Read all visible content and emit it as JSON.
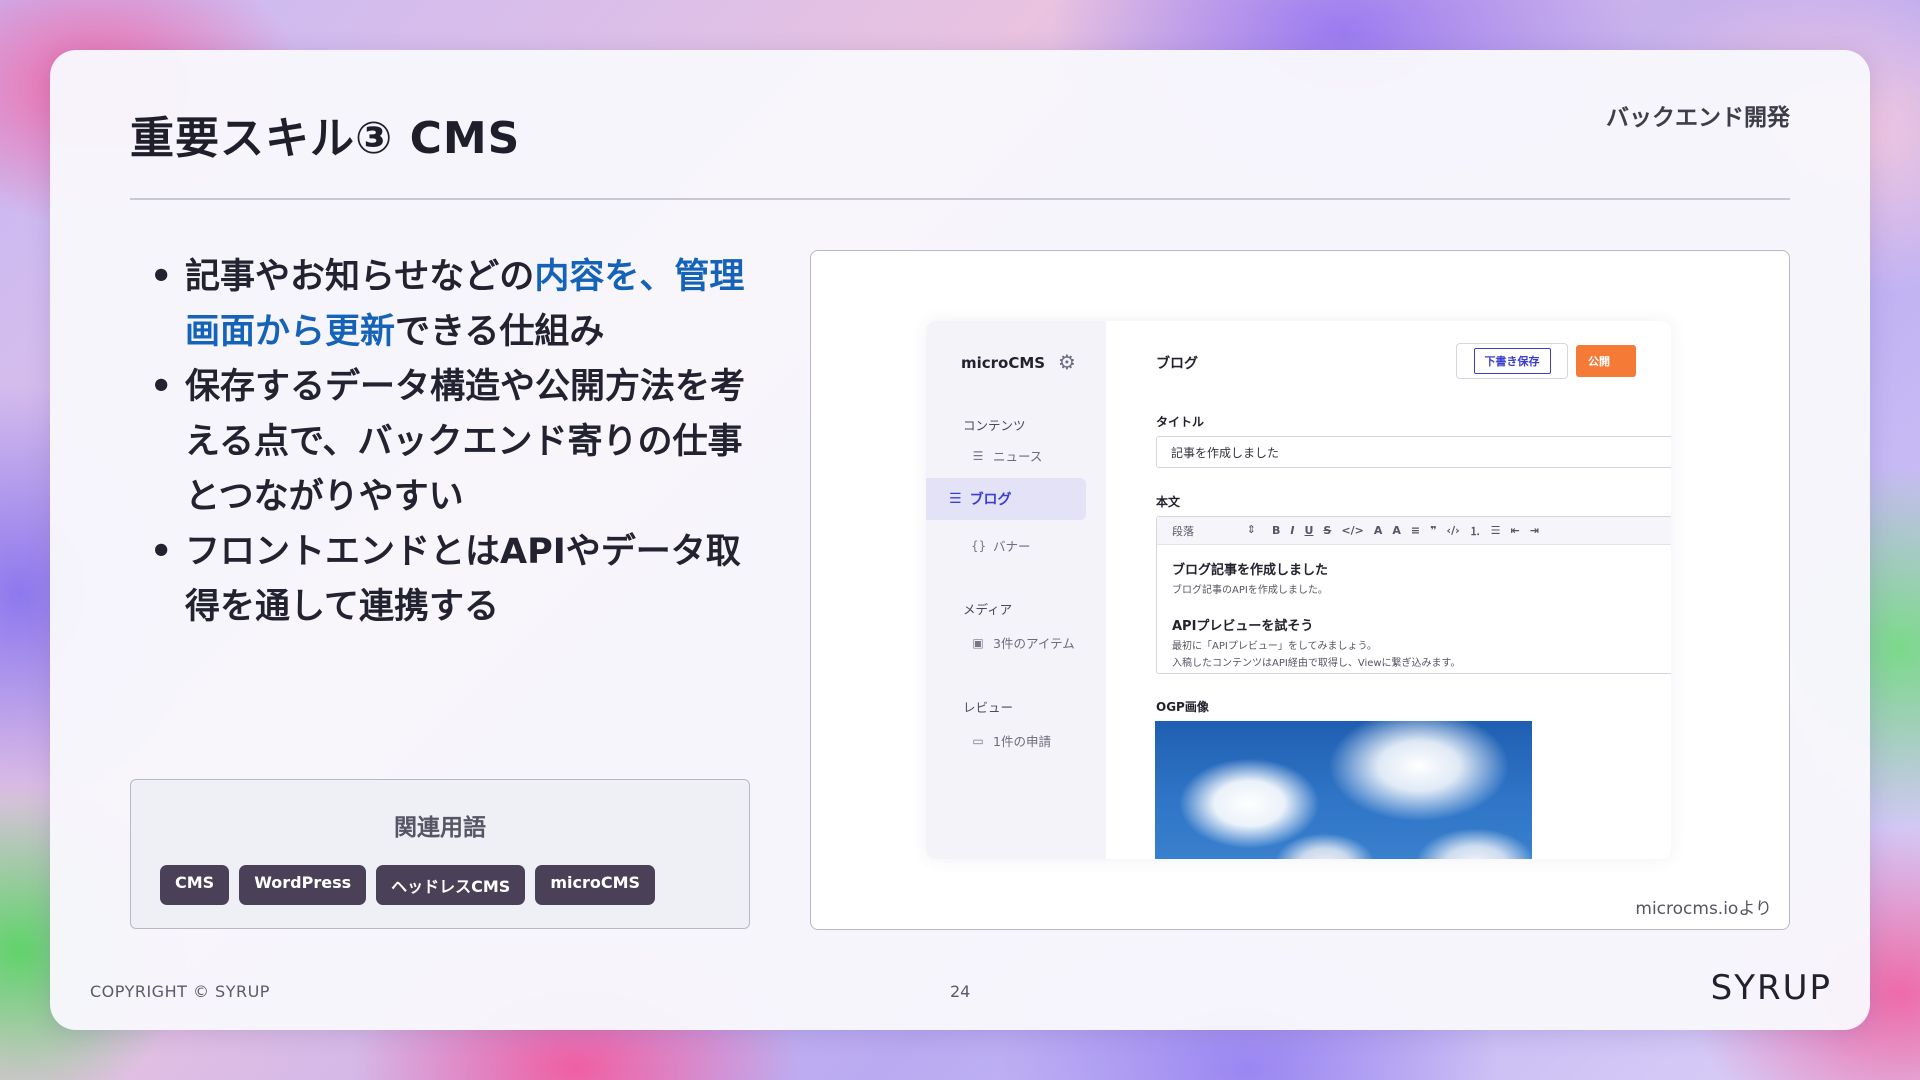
{
  "slide": {
    "title": "重要スキル③ CMS",
    "section": "バックエンド開発",
    "bullets": [
      {
        "pre": "記事やお知らせなどの",
        "hl": "内容を、管理画面から更新",
        "post": "できる仕組み"
      },
      {
        "pre": "保存するデータ構造や公開方法を考える点で、バックエンド寄りの仕事とつながりやすい",
        "hl": "",
        "post": ""
      },
      {
        "pre": "フロントエンドとはAPIやデータ取得を通して連携する",
        "hl": "",
        "post": ""
      }
    ],
    "related_terms": {
      "title": "関連用語",
      "tags": [
        "CMS",
        "WordPress",
        "ヘッドレスCMS",
        "microCMS"
      ]
    },
    "screenshot_credit": "microcms.ioより",
    "footer": {
      "copyright": "COPYRIGHT © SYRUP",
      "page": "24",
      "logo": "SYRUP"
    }
  },
  "cms_app": {
    "brand": "microCMS",
    "sidebar": {
      "content_section": "コンテンツ",
      "items": [
        "ニュース",
        "ブログ",
        "バナー"
      ],
      "media_section": "メディア",
      "media_item": "3件のアイテム",
      "review_section": "レビュー",
      "review_item": "1件の申請"
    },
    "header": {
      "title": "ブログ",
      "draft_button": "下書き保存",
      "publish_button": "公開"
    },
    "fields": {
      "title_label": "タイトル",
      "title_value": "記事を作成しました",
      "body_label": "本文",
      "paragraph_select": "段落",
      "toolbar": [
        "B",
        "I",
        "U",
        "S",
        "</>",
        "A",
        "A",
        "≡",
        "❞",
        "‹/›",
        "⒈",
        "☰",
        "⇤",
        "⇥"
      ],
      "body": {
        "h1": "ブログ記事を作成しました",
        "p1": "ブログ記事のAPIを作成しました。",
        "h2": "APIプレビューを試そう",
        "p2": "最初に「APIプレビュー」をしてみましょう。",
        "p3": "入稿したコンテンツはAPI経由で取得し、Viewに繋ぎ込みます。"
      },
      "ogp_label": "OGP画像"
    }
  }
}
